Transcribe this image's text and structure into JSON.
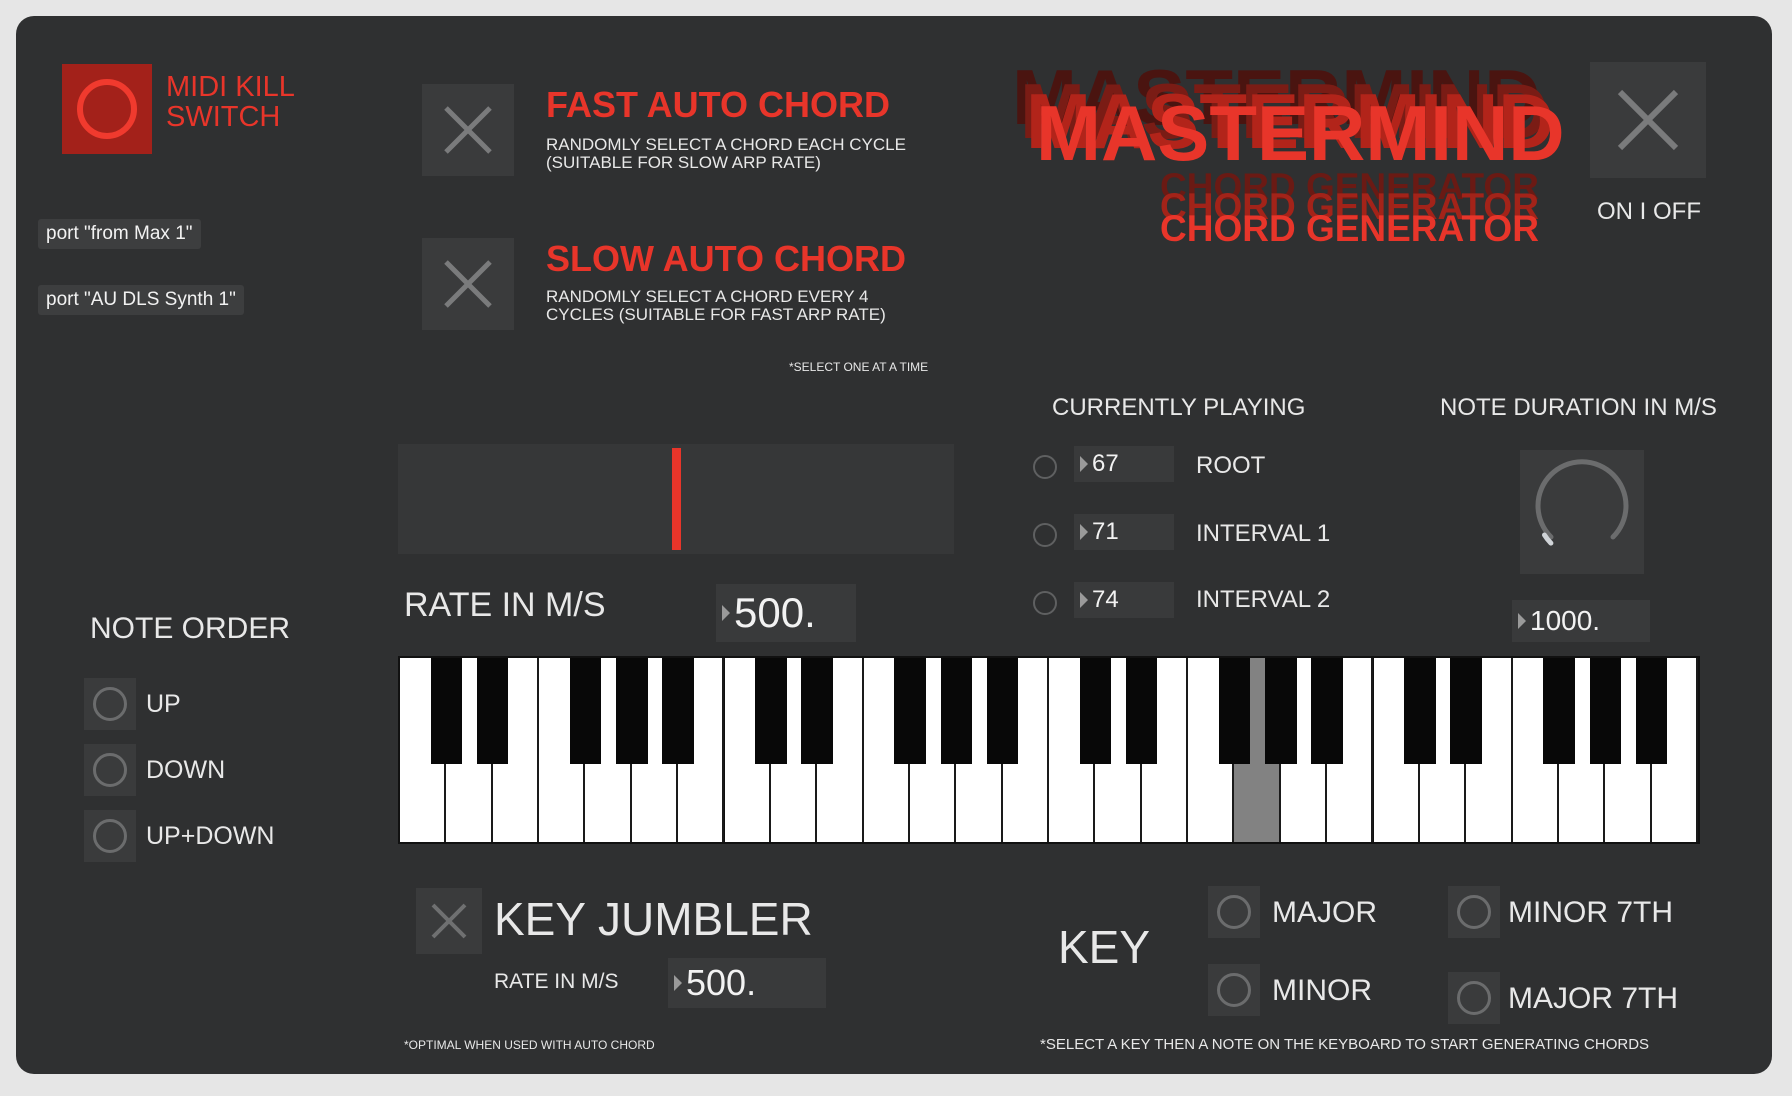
{
  "kill_switch": {
    "line1": "MIDI KILL",
    "line2": "SWITCH"
  },
  "ports": {
    "from": "port \"from Max 1\"",
    "to": "port \"AU DLS Synth 1\""
  },
  "fast_auto_chord": {
    "title": "FAST AUTO CHORD",
    "desc1": "RANDOMLY SELECT A CHORD EACH CYCLE",
    "desc2": "(SUITABLE FOR SLOW ARP RATE)"
  },
  "slow_auto_chord": {
    "title": "SLOW AUTO CHORD",
    "desc1": "RANDOMLY SELECT A CHORD EVERY 4",
    "desc2": "CYCLES (SUITABLE FOR FAST ARP RATE)"
  },
  "select_note": "*SELECT ONE AT A TIME",
  "logo": {
    "title": "MASTERMIND",
    "subtitle": "CHORD GENERATOR"
  },
  "power": {
    "label": "ON I OFF"
  },
  "currently_playing": {
    "heading": "CURRENTLY PLAYING",
    "rows": [
      {
        "value": "67",
        "label": "ROOT"
      },
      {
        "value": "71",
        "label": "INTERVAL 1"
      },
      {
        "value": "74",
        "label": "INTERVAL 2"
      }
    ]
  },
  "note_duration": {
    "heading": "NOTE DURATION IN M/S",
    "value": "1000.",
    "dial_fraction": 0.05
  },
  "rate": {
    "label": "RATE IN M/S",
    "value": "500.",
    "slider_fraction": 0.5
  },
  "note_order": {
    "heading": "NOTE ORDER",
    "options": [
      "UP",
      "DOWN",
      "UP+DOWN"
    ]
  },
  "keyboard": {
    "white_keys": 28,
    "highlighted_white_key": 18
  },
  "key_jumbler": {
    "title": "KEY JUMBLER",
    "rate_label": "RATE IN M/S",
    "rate_value": "500.",
    "note": "*OPTIMAL WHEN USED WITH AUTO CHORD"
  },
  "key_select": {
    "label": "KEY",
    "options": [
      "MAJOR",
      "MINOR",
      "MINOR 7TH",
      "MAJOR 7TH"
    ],
    "note": "*SELECT A KEY THEN A NOTE ON THE KEYBOARD TO START GENERATING CHORDS"
  },
  "colors": {
    "accent": "#e8352a",
    "panel": "#2f3031",
    "control": "#3a3b3c"
  },
  "icons": {
    "toggle": "x-icon",
    "kill": "circle-icon",
    "radio": "radio-ring-icon",
    "dial": "dial-icon"
  }
}
